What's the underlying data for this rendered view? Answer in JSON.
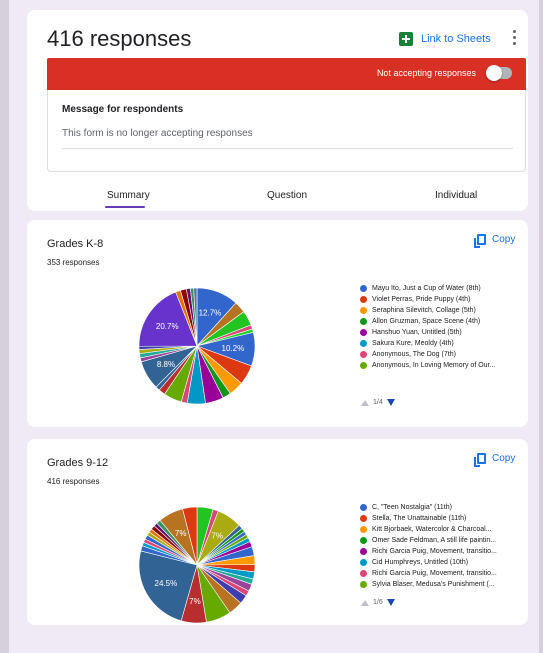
{
  "header": {
    "responses_title": "416 responses",
    "link_to_sheets": "Link to Sheets",
    "not_accepting": "Not accepting responses",
    "message_label": "Message for respondents",
    "message_value": "This form is no longer accepting responses"
  },
  "tabs": [
    {
      "label": "Summary",
      "active": true
    },
    {
      "label": "Question",
      "active": false
    },
    {
      "label": "Individual",
      "active": false
    }
  ],
  "copy_label": "Copy",
  "questions": [
    {
      "title": "Grades K-8",
      "count": "353 responses",
      "pager": "1/4",
      "legend": [
        {
          "label": "Mayu Ito, Just a Cup of Water (8th)",
          "color": "#3366cc"
        },
        {
          "label": "Violet Perras, Pride Puppy (4th)",
          "color": "#dc3912"
        },
        {
          "label": "Seraphina Silevitch, Collage (5th)",
          "color": "#ff9900"
        },
        {
          "label": "Allon Gruzman, Space Scene (4th)",
          "color": "#109618"
        },
        {
          "label": "Hanshuo Yuan, Untitled (5th)",
          "color": "#990099"
        },
        {
          "label": "Sakura Kure, Meoldy (4th)",
          "color": "#0099c6"
        },
        {
          "label": "Anonymous, The Dog (7th)",
          "color": "#dd4477"
        },
        {
          "label": "Anonymous, In Loving Memory of Our...",
          "color": "#66aa00"
        }
      ]
    },
    {
      "title": "Grades 9-12",
      "count": "416 responses",
      "pager": "1/6",
      "legend": [
        {
          "label": "C, \"Teen Nostalgia\" (11th)",
          "color": "#3366cc"
        },
        {
          "label": "Stella, The Unattainable (11th)",
          "color": "#dc3912"
        },
        {
          "label": "Kitt Bjorbaek, Watercolor & Charcoal...",
          "color": "#ff9900"
        },
        {
          "label": "Omer Sade Feldman, A still life paintin...",
          "color": "#109618"
        },
        {
          "label": "Richi Garcia Puig, Movement, transitio...",
          "color": "#990099"
        },
        {
          "label": "Cid Humphreys, Untitled (10th)",
          "color": "#0099c6"
        },
        {
          "label": "Richi Garcia Puig, Movement, transitio...",
          "color": "#dd4477"
        },
        {
          "label": "Sylvia Blaser, Medusa's Punishment (...",
          "color": "#66aa00"
        }
      ]
    }
  ],
  "chart_data": [
    {
      "type": "pie",
      "title": "Grades K-8",
      "slices": [
        {
          "value": 12.7,
          "color": "#3366cc",
          "label": "12.7%"
        },
        {
          "value": 3.5,
          "color": "#b77322"
        },
        {
          "value": 4.5,
          "color": "#22c422"
        },
        {
          "value": 1.3,
          "color": "#dd4477"
        },
        {
          "value": 1.0,
          "color": "#16d620"
        },
        {
          "value": 10.2,
          "color": "#3366cc",
          "label": "10.2%"
        },
        {
          "value": 6.0,
          "color": "#dc3912"
        },
        {
          "value": 4.5,
          "color": "#ff9900"
        },
        {
          "value": 2.5,
          "color": "#109618"
        },
        {
          "value": 5.5,
          "color": "#990099"
        },
        {
          "value": 5.5,
          "color": "#0099c6"
        },
        {
          "value": 1.8,
          "color": "#dd4477"
        },
        {
          "value": 5.5,
          "color": "#66aa00"
        },
        {
          "value": 2.0,
          "color": "#b82e2e"
        },
        {
          "value": 1.3,
          "color": "#316395"
        },
        {
          "value": 8.8,
          "color": "#316395",
          "label": "8.8%"
        },
        {
          "value": 1.2,
          "color": "#994499"
        },
        {
          "value": 1.3,
          "color": "#22aa99"
        },
        {
          "value": 1.2,
          "color": "#aaaa11"
        },
        {
          "value": 1.0,
          "color": "#3b3eac"
        },
        {
          "value": 20.7,
          "color": "#6633cc",
          "label": "20.7%"
        },
        {
          "value": 1.5,
          "color": "#e67300"
        },
        {
          "value": 1.8,
          "color": "#8b0707"
        },
        {
          "value": 1.2,
          "color": "#651067"
        },
        {
          "value": 1.0,
          "color": "#329262"
        },
        {
          "value": 1.0,
          "color": "#5574a6"
        }
      ]
    },
    {
      "type": "pie",
      "title": "Grades 9-12",
      "slices": [
        {
          "value": 4.5,
          "color": "#22c422"
        },
        {
          "value": 1.5,
          "color": "#dd4477"
        },
        {
          "value": 7.0,
          "color": "#aaaa11",
          "label": "7%"
        },
        {
          "value": 1.2,
          "color": "#316395"
        },
        {
          "value": 1.0,
          "color": "#109618"
        },
        {
          "value": 1.0,
          "color": "#3366cc"
        },
        {
          "value": 1.0,
          "color": "#66aa00"
        },
        {
          "value": 1.2,
          "color": "#0099c6"
        },
        {
          "value": 1.5,
          "color": "#990099"
        },
        {
          "value": 2.5,
          "color": "#3366cc"
        },
        {
          "value": 2.5,
          "color": "#ff9900"
        },
        {
          "value": 2.0,
          "color": "#dc3912"
        },
        {
          "value": 2.0,
          "color": "#0099c6"
        },
        {
          "value": 1.5,
          "color": "#22aa99"
        },
        {
          "value": 2.0,
          "color": "#994499"
        },
        {
          "value": 1.5,
          "color": "#dd4477"
        },
        {
          "value": 2.5,
          "color": "#3b3eac"
        },
        {
          "value": 4.0,
          "color": "#b77322"
        },
        {
          "value": 7.0,
          "color": "#66aa00"
        },
        {
          "value": 7.0,
          "color": "#b82e2e",
          "label": "7%"
        },
        {
          "value": 24.5,
          "color": "#316395",
          "label": "24.5%"
        },
        {
          "value": 1.5,
          "color": "#3366cc"
        },
        {
          "value": 1.0,
          "color": "#0099c6"
        },
        {
          "value": 1.0,
          "color": "#dd4477"
        },
        {
          "value": 1.2,
          "color": "#3366cc"
        },
        {
          "value": 1.0,
          "color": "#aaaa11"
        },
        {
          "value": 1.0,
          "color": "#e67300"
        },
        {
          "value": 1.2,
          "color": "#8b0707"
        },
        {
          "value": 1.0,
          "color": "#651067"
        },
        {
          "value": 1.2,
          "color": "#329262"
        },
        {
          "value": 7.0,
          "color": "#b77322",
          "label": "7%"
        },
        {
          "value": 4.0,
          "color": "#dc3912"
        }
      ]
    }
  ]
}
